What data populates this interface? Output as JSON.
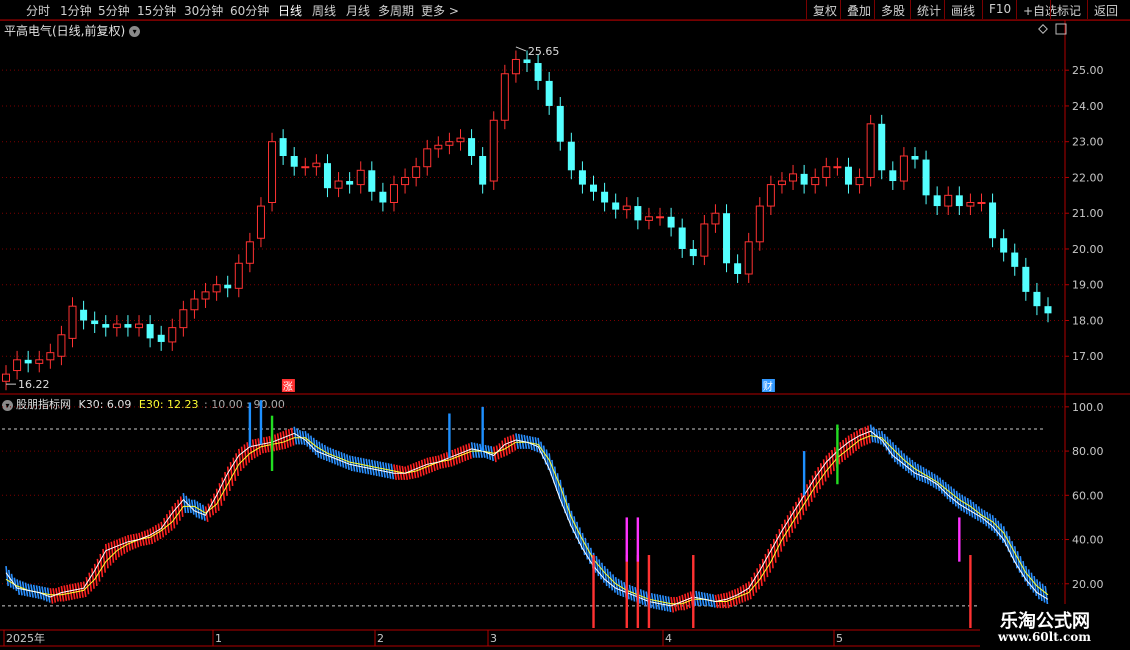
{
  "toolbar": {
    "periods": [
      "分时",
      "1分钟",
      "5分钟",
      "15分钟",
      "30分钟",
      "60分钟",
      "日线",
      "周线",
      "月线",
      "多周期",
      "更多 >"
    ],
    "active_period": "日线",
    "actions": [
      "复权",
      "叠加",
      "多股",
      "统计",
      "画线",
      "F10",
      "+自选",
      "标记",
      "返回"
    ]
  },
  "stock": {
    "title": "平高电气(日线,前复权)",
    "high_label": "25.65",
    "low_label": "16.22",
    "y_ticks": [
      "25.00",
      "24.00",
      "23.00",
      "22.00",
      "21.00",
      "20.00",
      "19.00",
      "18.00",
      "17.00"
    ],
    "markers": [
      "涨",
      "财"
    ]
  },
  "indicator": {
    "name": "股朋指标网",
    "k_label": "K30: 6.09",
    "e_label": "E30: 12.23",
    "levels_label": ": 10.00 : 90.00",
    "y_ticks": [
      "100.0",
      "80.00",
      "60.00",
      "40.00",
      "20.00"
    ]
  },
  "time_axis": [
    "2025年",
    "1",
    "2",
    "3",
    "4",
    "5"
  ],
  "watermark": {
    "main": "乐淘公式网",
    "url": "www.60lt.com"
  },
  "colors": {
    "up": "#ff3232",
    "down": "#54ffff",
    "bg": "#000000",
    "frame": "#b00000",
    "blue_bar": "#1e90ff",
    "green_bar": "#22dd22",
    "magenta_bar": "#ff33ff"
  },
  "chart_data": [
    {
      "type": "candlestick",
      "title": "平高电气(日线,前复权)",
      "ylim": [
        16.0,
        25.9
      ],
      "highest": 25.65,
      "lowest": 16.22,
      "close": [
        16.5,
        16.9,
        16.8,
        16.9,
        17.1,
        17.6,
        18.4,
        18.0,
        17.9,
        17.8,
        17.9,
        17.8,
        17.9,
        17.5,
        17.4,
        17.8,
        18.3,
        18.6,
        18.8,
        19.0,
        18.9,
        19.6,
        20.2,
        21.2,
        23.0,
        22.6,
        22.3,
        22.3,
        22.4,
        21.7,
        21.9,
        21.8,
        22.2,
        21.6,
        21.3,
        21.8,
        22.0,
        22.3,
        22.8,
        22.9,
        23.0,
        23.1,
        22.6,
        21.8,
        23.6,
        24.9,
        25.3,
        25.2,
        24.7,
        24.0,
        23.0,
        22.2,
        21.8,
        21.6,
        21.3,
        21.1,
        21.2,
        20.8,
        20.9,
        20.9,
        20.6,
        20.0,
        19.8,
        20.7,
        21.0,
        19.6,
        19.3,
        20.2,
        21.2,
        21.8,
        21.9,
        22.1,
        21.8,
        22.0,
        22.3,
        22.3,
        21.8,
        22.0,
        23.5,
        22.2,
        21.9,
        22.6,
        22.5,
        21.5,
        21.2,
        21.5,
        21.2,
        21.3,
        21.3,
        20.3,
        19.9,
        19.5,
        18.8,
        18.4,
        18.2
      ],
      "open": [
        16.3,
        16.6,
        16.9,
        16.8,
        16.9,
        17.0,
        17.5,
        18.3,
        18.0,
        17.9,
        17.8,
        17.9,
        17.8,
        17.9,
        17.6,
        17.4,
        17.8,
        18.3,
        18.6,
        18.8,
        19.0,
        18.9,
        19.6,
        20.3,
        21.3,
        23.1,
        22.6,
        22.3,
        22.3,
        22.4,
        21.7,
        21.9,
        21.8,
        22.2,
        21.6,
        21.3,
        21.8,
        22.0,
        22.3,
        22.8,
        22.9,
        23.0,
        23.1,
        22.6,
        21.9,
        23.6,
        24.9,
        25.3,
        25.2,
        24.7,
        24.0,
        23.0,
        22.2,
        21.8,
        21.6,
        21.3,
        21.1,
        21.2,
        20.8,
        20.9,
        20.9,
        20.6,
        20.0,
        19.8,
        20.7,
        21.0,
        19.6,
        19.3,
        20.2,
        21.2,
        21.8,
        21.9,
        22.1,
        21.8,
        22.0,
        22.3,
        22.3,
        21.8,
        22.0,
        23.5,
        22.2,
        21.9,
        22.6,
        22.5,
        21.5,
        21.2,
        21.5,
        21.2,
        21.3,
        21.3,
        20.3,
        19.9,
        19.5,
        18.8,
        18.4
      ]
    },
    {
      "type": "line",
      "title": "股朋指标网",
      "ylim": [
        0,
        104
      ],
      "series": [
        {
          "name": "K30",
          "values": [
            25,
            18,
            17,
            16,
            14,
            16,
            17,
            18,
            26,
            35,
            37,
            39,
            40,
            42,
            45,
            52,
            58,
            53,
            51,
            60,
            70,
            78,
            82,
            83,
            84,
            86,
            88,
            85,
            80,
            78,
            76,
            74,
            73,
            72,
            71,
            70,
            70,
            72,
            74,
            75,
            77,
            79,
            81,
            80,
            78,
            83,
            85,
            84,
            82,
            72,
            58,
            46,
            36,
            28,
            22,
            18,
            16,
            14,
            12,
            11,
            10,
            12,
            14,
            13,
            12,
            13,
            15,
            18,
            26,
            35,
            44,
            52,
            60,
            68,
            75,
            80,
            84,
            87,
            89,
            85,
            78,
            74,
            70,
            68,
            65,
            60,
            56,
            53,
            50,
            46,
            40,
            30,
            22,
            16,
            13
          ]
        },
        {
          "name": "E30",
          "values": [
            22,
            19,
            17,
            16,
            15,
            15,
            16,
            17,
            22,
            30,
            35,
            38,
            40,
            41,
            44,
            48,
            55,
            55,
            52,
            56,
            65,
            74,
            79,
            82,
            83,
            84,
            86,
            86,
            82,
            79,
            77,
            75,
            74,
            73,
            72,
            71,
            70,
            71,
            73,
            75,
            76,
            78,
            80,
            80,
            79,
            81,
            84,
            84,
            83,
            76,
            64,
            50,
            40,
            31,
            25,
            20,
            17,
            15,
            13,
            12,
            11,
            11,
            13,
            13,
            12,
            12,
            14,
            16,
            22,
            30,
            40,
            48,
            56,
            64,
            71,
            77,
            81,
            85,
            87,
            86,
            81,
            76,
            72,
            69,
            66,
            62,
            58,
            55,
            51,
            48,
            43,
            34,
            25,
            19,
            15
          ]
        }
      ],
      "reference_lines": [
        10.0,
        90.0
      ],
      "blue_signals": [
        22,
        23,
        40,
        43,
        72
      ],
      "green_signals": [
        24,
        75
      ],
      "magenta_signals": [
        56,
        57,
        86
      ],
      "red_signals": [
        53,
        56,
        57,
        58,
        62,
        87
      ]
    }
  ]
}
